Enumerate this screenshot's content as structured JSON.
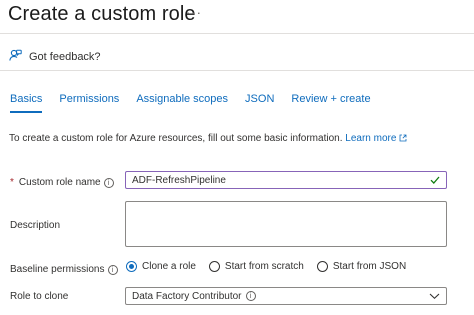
{
  "header": {
    "title": "Create a custom role",
    "more": "···"
  },
  "feedback": {
    "label": "Got feedback?"
  },
  "tabs": [
    {
      "label": "Basics",
      "active": true
    },
    {
      "label": "Permissions",
      "active": false
    },
    {
      "label": "Assignable scopes",
      "active": false
    },
    {
      "label": "JSON",
      "active": false
    },
    {
      "label": "Review + create",
      "active": false
    }
  ],
  "intro": {
    "text": "To create a custom role for Azure resources, fill out some basic information.",
    "link": "Learn more"
  },
  "form": {
    "role_name": {
      "required_marker": "*",
      "label": "Custom role name",
      "value": "ADF-RefreshPipeline",
      "valid": true
    },
    "description": {
      "label": "Description",
      "value": ""
    },
    "baseline": {
      "label": "Baseline permissions",
      "options": [
        "Clone a role",
        "Start from scratch",
        "Start from JSON"
      ],
      "selected": "Clone a role"
    },
    "clone": {
      "label": "Role to clone",
      "value": "Data Factory Contributor"
    }
  },
  "colors": {
    "accent": "#0f6cbd",
    "valid_check": "#107c10",
    "required": "#a4262c"
  }
}
